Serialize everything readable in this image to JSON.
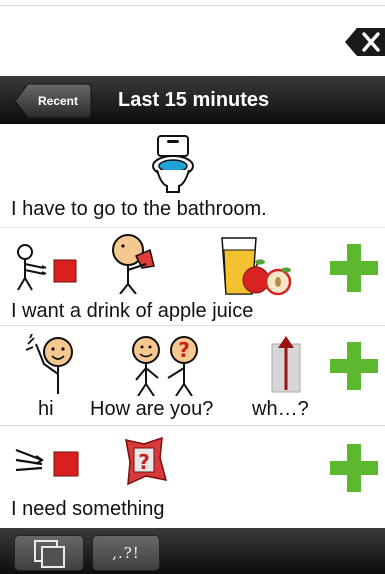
{
  "header": {
    "back_label": "Recent",
    "title": "Last 15 minutes",
    "clear_icon": "close-x-icon"
  },
  "phrases": [
    {
      "text": "I have to go to the bathroom.",
      "symbols": [
        "toilet-icon"
      ]
    },
    {
      "text": "I want a drink of apple juice",
      "symbols": [
        "want-icon",
        "drink-icon",
        "apple-juice-icon"
      ],
      "action_icon": "plus-icon"
    },
    {
      "words": [
        "hi",
        "How are you?",
        "wh…?"
      ],
      "symbols": [
        "hi-wave-icon",
        "how-are-you-icon",
        "question-arrow-icon"
      ],
      "action_icon": "plus-icon"
    },
    {
      "text": "I need something",
      "symbols": [
        "need-icon",
        "something-question-icon"
      ],
      "action_icon": "plus-icon"
    }
  ],
  "toolbar": {
    "punctuation_label": ",.?!",
    "icons": [
      "copy-pages-icon"
    ]
  },
  "colors": {
    "plus_green": "#5cb82e",
    "bar_dark": "#111111",
    "accent_red": "#cc1f1f"
  }
}
